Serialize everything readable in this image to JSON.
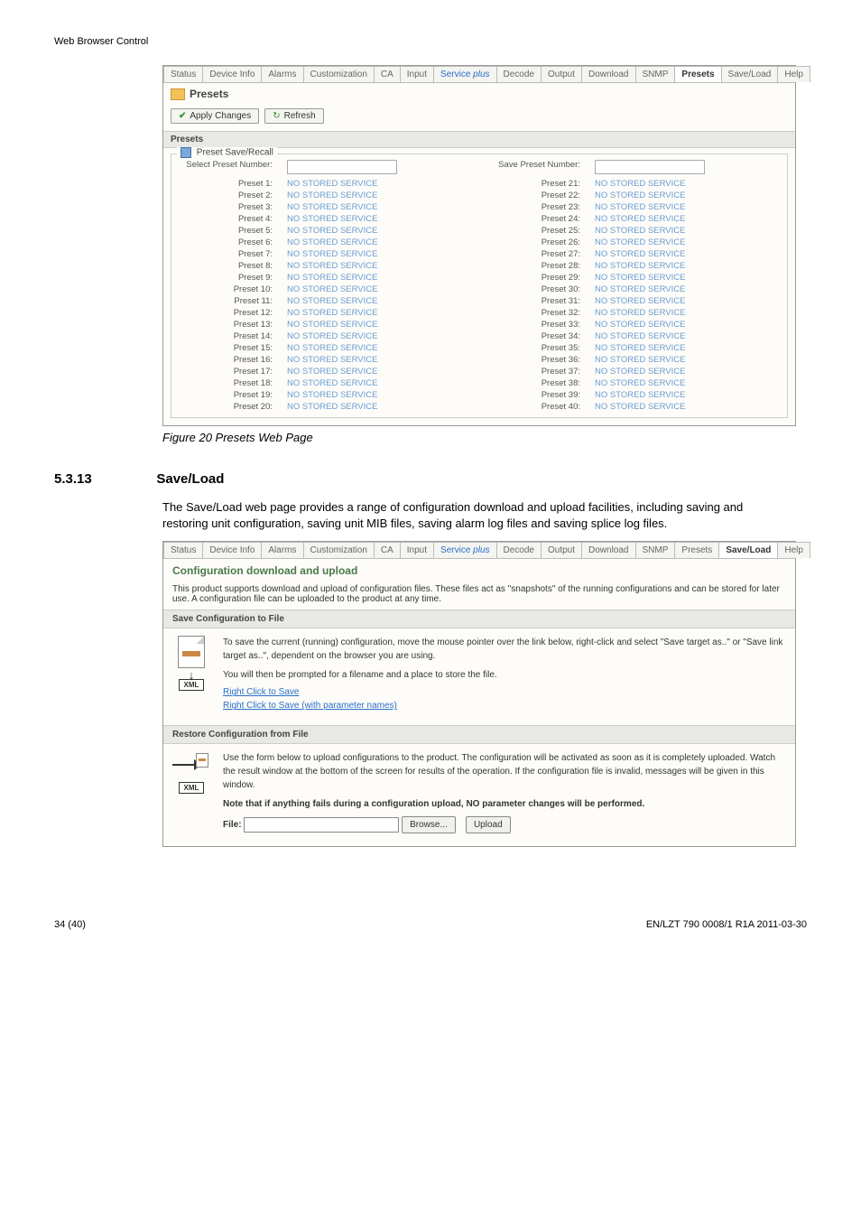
{
  "page_header": "Web Browser Control",
  "tabs": [
    "Status",
    "Device Info",
    "Alarms",
    "Customization",
    "CA",
    "Input",
    "Service plus",
    "Decode",
    "Output",
    "Download",
    "SNMP",
    "Presets",
    "Save/Load",
    "Help"
  ],
  "presets_screenshot": {
    "active_tab": "Presets",
    "title": "Presets",
    "buttons": {
      "apply": "Apply Changes",
      "refresh": "Refresh"
    },
    "subheader": "Presets",
    "legend": "Preset Save/Recall",
    "select_label": "Select Preset Number:",
    "save_label": "Save Preset Number:",
    "left_rows": [
      {
        "label": "Preset 1:",
        "value": "NO STORED SERVICE"
      },
      {
        "label": "Preset 2:",
        "value": "NO STORED SERVICE"
      },
      {
        "label": "Preset 3:",
        "value": "NO STORED SERVICE"
      },
      {
        "label": "Preset 4:",
        "value": "NO STORED SERVICE"
      },
      {
        "label": "Preset 5:",
        "value": "NO STORED SERVICE"
      },
      {
        "label": "Preset 6:",
        "value": "NO STORED SERVICE"
      },
      {
        "label": "Preset 7:",
        "value": "NO STORED SERVICE"
      },
      {
        "label": "Preset 8:",
        "value": "NO STORED SERVICE"
      },
      {
        "label": "Preset 9:",
        "value": "NO STORED SERVICE"
      },
      {
        "label": "Preset 10:",
        "value": "NO STORED SERVICE"
      },
      {
        "label": "Preset 11:",
        "value": "NO STORED SERVICE"
      },
      {
        "label": "Preset 12:",
        "value": "NO STORED SERVICE"
      },
      {
        "label": "Preset 13:",
        "value": "NO STORED SERVICE"
      },
      {
        "label": "Preset 14:",
        "value": "NO STORED SERVICE"
      },
      {
        "label": "Preset 15:",
        "value": "NO STORED SERVICE"
      },
      {
        "label": "Preset 16:",
        "value": "NO STORED SERVICE"
      },
      {
        "label": "Preset 17:",
        "value": "NO STORED SERVICE"
      },
      {
        "label": "Preset 18:",
        "value": "NO STORED SERVICE"
      },
      {
        "label": "Preset 19:",
        "value": "NO STORED SERVICE"
      },
      {
        "label": "Preset 20:",
        "value": "NO STORED SERVICE"
      }
    ],
    "right_rows": [
      {
        "label": "Preset 21:",
        "value": "NO STORED SERVICE"
      },
      {
        "label": "Preset 22:",
        "value": "NO STORED SERVICE"
      },
      {
        "label": "Preset 23:",
        "value": "NO STORED SERVICE"
      },
      {
        "label": "Preset 24:",
        "value": "NO STORED SERVICE"
      },
      {
        "label": "Preset 25:",
        "value": "NO STORED SERVICE"
      },
      {
        "label": "Preset 26:",
        "value": "NO STORED SERVICE"
      },
      {
        "label": "Preset 27:",
        "value": "NO STORED SERVICE"
      },
      {
        "label": "Preset 28:",
        "value": "NO STORED SERVICE"
      },
      {
        "label": "Preset 29:",
        "value": "NO STORED SERVICE"
      },
      {
        "label": "Preset 30:",
        "value": "NO STORED SERVICE"
      },
      {
        "label": "Preset 31:",
        "value": "NO STORED SERVICE"
      },
      {
        "label": "Preset 32:",
        "value": "NO STORED SERVICE"
      },
      {
        "label": "Preset 33:",
        "value": "NO STORED SERVICE"
      },
      {
        "label": "Preset 34:",
        "value": "NO STORED SERVICE"
      },
      {
        "label": "Preset 35:",
        "value": "NO STORED SERVICE"
      },
      {
        "label": "Preset 36:",
        "value": "NO STORED SERVICE"
      },
      {
        "label": "Preset 37:",
        "value": "NO STORED SERVICE"
      },
      {
        "label": "Preset 38:",
        "value": "NO STORED SERVICE"
      },
      {
        "label": "Preset 39:",
        "value": "NO STORED SERVICE"
      },
      {
        "label": "Preset 40:",
        "value": "NO STORED SERVICE"
      }
    ]
  },
  "figure_caption": "Figure 20   Presets Web Page",
  "section": {
    "number": "5.3.13",
    "title": "Save/Load"
  },
  "body_paragraph": "The Save/Load web page provides a range of configuration download and upload facilities, including saving and restoring unit configuration, saving unit MIB files, saving alarm log files and saving splice log files.",
  "saveload_screenshot": {
    "active_tab": "Save/Load",
    "title": "Configuration download and upload",
    "intro": "This product supports download and upload of configuration files. These files act as \"snapshots\" of the running configurations and can be stored for later use. A configuration file can be uploaded to the product at any time.",
    "save_header": "Save Configuration to File",
    "save_text1": "To save the current (running) configuration, move the mouse pointer over the link below, right-click and select \"Save target as..\" or \"Save link target as..\", dependent on the browser you are using.",
    "save_text2": "You will then be prompted for a filename and a place to store the file.",
    "link1": "Right Click to Save",
    "link2": "Right Click to Save (with parameter names)",
    "restore_header": "Restore Configuration from File",
    "restore_text": "Use the form below to upload configurations to the product. The configuration will be activated as soon as it is completely uploaded. Watch the result window at the bottom of the screen for results of the operation. If the configuration file is invalid, messages will be given in this window.",
    "restore_note": "Note that if anything fails during a configuration upload, NO parameter changes will be performed.",
    "file_label": "File:",
    "browse": "Browse...",
    "upload": "Upload",
    "xml_label": "XML"
  },
  "footer": {
    "left": "34 (40)",
    "right": "EN/LZT 790 0008/1 R1A 2011-03-30"
  }
}
